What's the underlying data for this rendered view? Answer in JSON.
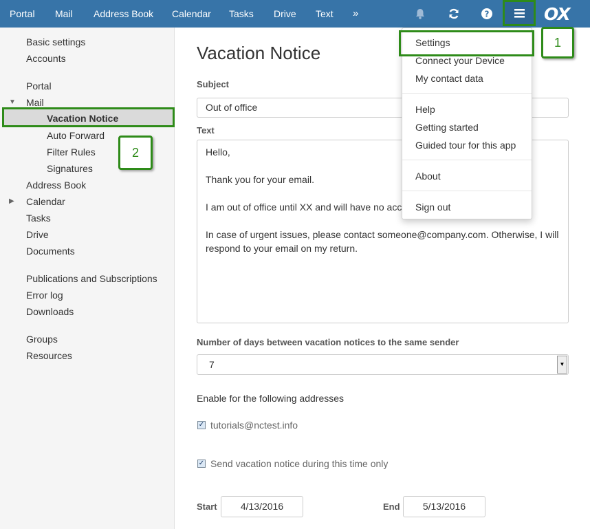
{
  "topnav": {
    "items": [
      "Portal",
      "Mail",
      "Address Book",
      "Calendar",
      "Tasks",
      "Drive",
      "Text"
    ],
    "more": "»",
    "icons": [
      "bell-icon",
      "refresh-icon",
      "help-icon",
      "menu-icon"
    ],
    "logo": "OX"
  },
  "sidebar": {
    "basic_settings": "Basic settings",
    "accounts": "Accounts",
    "portal": "Portal",
    "mail": "Mail",
    "vacation_notice": "Vacation Notice",
    "auto_forward": "Auto Forward",
    "filter_rules": "Filter Rules",
    "signatures": "Signatures",
    "address_book": "Address Book",
    "calendar": "Calendar",
    "tasks": "Tasks",
    "drive": "Drive",
    "documents": "Documents",
    "publications": "Publications and Subscriptions",
    "error_log": "Error log",
    "downloads": "Downloads",
    "groups": "Groups",
    "resources": "Resources"
  },
  "callouts": {
    "one": "1",
    "two": "2"
  },
  "main": {
    "title": "Vacation Notice",
    "subject_label": "Subject",
    "subject_value": "Out of office",
    "text_label": "Text",
    "text_lines": [
      "Hello,",
      "Thank you for your email.",
      "I am out of office until XX and will have no access to email.",
      "In case of urgent issues, please contact someone@company.com. Otherwise, I will respond to your email on my return."
    ],
    "days_label": "Number of days between vacation notices to the same sender",
    "days_value": "7",
    "addresses_label": "Enable for the following addresses",
    "address_option": "tutorials@nctest.info",
    "address_checked": true,
    "time_only_label": "Send vacation notice during this time only",
    "time_only_checked": true,
    "start_label": "Start",
    "start_value": "4/13/2016",
    "end_label": "End",
    "end_value": "5/13/2016"
  },
  "dropdown": {
    "settings": "Settings",
    "connect_device": "Connect your Device",
    "contact_data": "My contact data",
    "help": "Help",
    "getting_started": "Getting started",
    "guided_tour": "Guided tour for this app",
    "about": "About",
    "sign_out": "Sign out"
  },
  "colors": {
    "topbar": "#3774a8",
    "highlight_green": "#2e8b19",
    "sidebar_bg": "#f5f5f5"
  }
}
